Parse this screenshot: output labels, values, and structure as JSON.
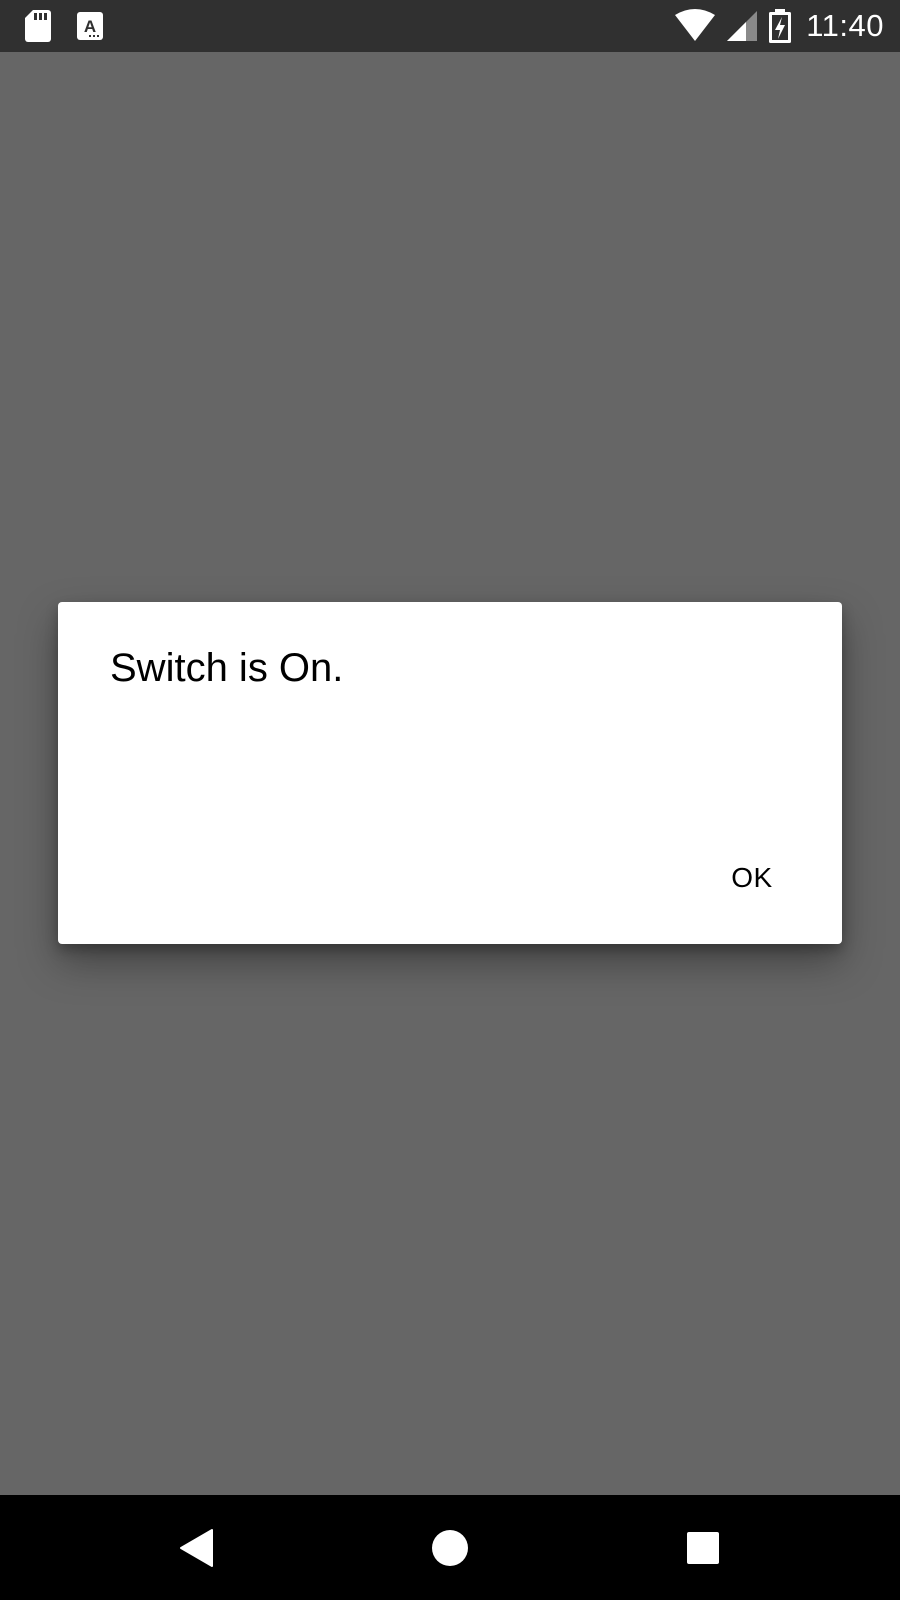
{
  "status_bar": {
    "time": "11:40",
    "icons": {
      "left": [
        "sd-card-icon",
        "text-app-icon"
      ],
      "right": [
        "wifi-icon",
        "cellular-signal-icon",
        "battery-charging-icon"
      ]
    },
    "notification_icon_letter": "A"
  },
  "dialog": {
    "message": "Switch is On.",
    "ok_label": "OK"
  },
  "nav_bar": {
    "buttons": [
      "back-icon",
      "home-icon",
      "recents-icon"
    ]
  },
  "colors": {
    "status_bar_bg": "#303030",
    "scrim_bg": "#666666",
    "dialog_bg": "#ffffff",
    "nav_bar_bg": "#000000",
    "text": "#000000"
  }
}
